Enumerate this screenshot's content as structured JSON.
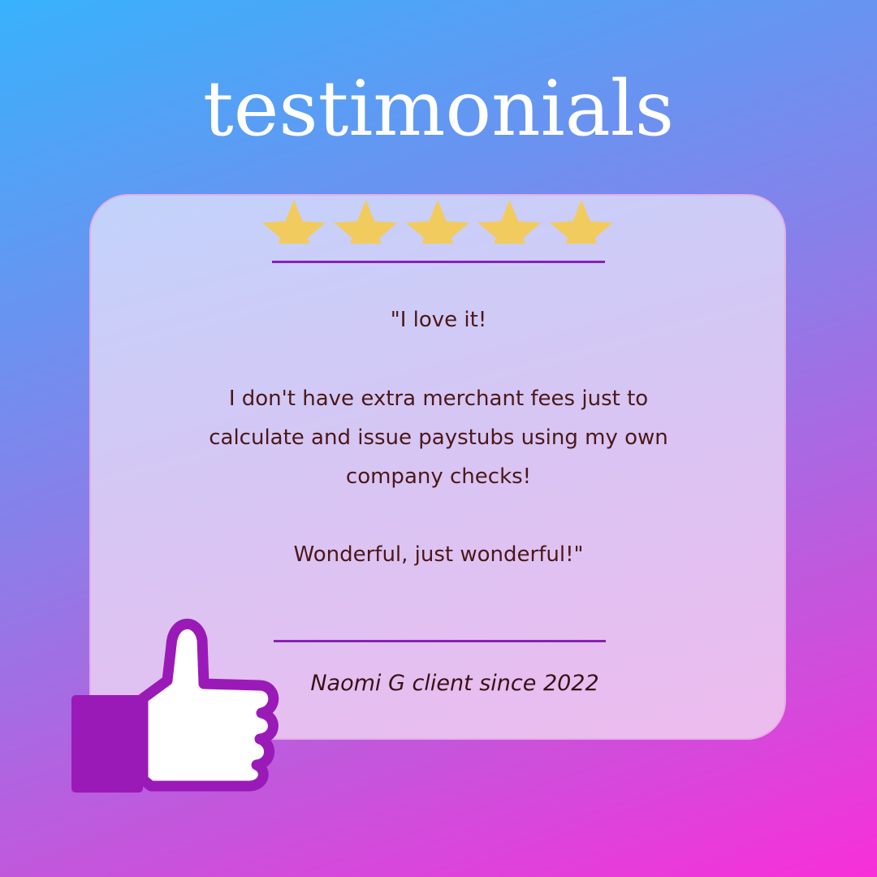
{
  "header": {
    "title": "testimonials"
  },
  "rating": {
    "value": 5,
    "max": 5,
    "star_color": "#f2cb5e",
    "icon": "star-icon"
  },
  "quote": {
    "line1": "\"I love it!",
    "paragraph2": [
      "I don't have extra merchant fees just to",
      "calculate and issue paystubs using my own",
      "company checks!"
    ],
    "line3": "Wonderful, just wonderful!\""
  },
  "attribution": "Naomi G client since 2022",
  "colors": {
    "accent": "#8a20b8",
    "thumb_cuff": "#9a1ab8",
    "text": "#4b1818"
  },
  "decoration": {
    "icon": "thumbs-up-icon"
  }
}
